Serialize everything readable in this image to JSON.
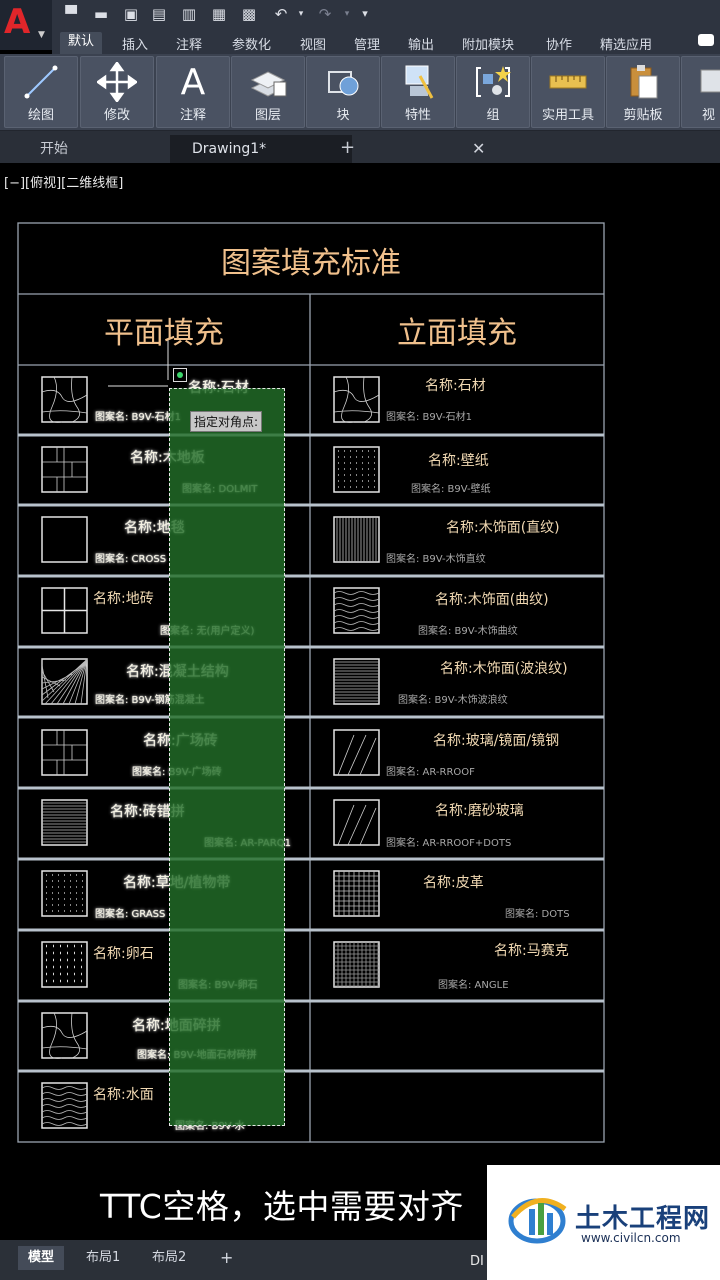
{
  "app": {
    "logo_letter": "A"
  },
  "ribbon_tabs": [
    "默认",
    "插入",
    "注释",
    "参数化",
    "视图",
    "管理",
    "输出",
    "附加模块",
    "协作",
    "精选应用"
  ],
  "ribbon_buttons": [
    {
      "label": "绘图",
      "icon": "line-draw-icon"
    },
    {
      "label": "修改",
      "icon": "move-arrows-icon"
    },
    {
      "label": "注释",
      "icon": "text-a-icon"
    },
    {
      "label": "图层",
      "icon": "layers-icon"
    },
    {
      "label": "块",
      "icon": "block-icon"
    },
    {
      "label": "特性",
      "icon": "properties-icon"
    },
    {
      "label": "组",
      "icon": "group-icon"
    },
    {
      "label": "实用工具",
      "icon": "measure-icon"
    },
    {
      "label": "剪贴板",
      "icon": "clipboard-icon"
    },
    {
      "label": "视",
      "icon": "view-icon"
    }
  ],
  "file_tabs": {
    "start": "开始",
    "drawing": "Drawing1*",
    "close": "✕",
    "add": "+"
  },
  "viewport_label": "[−][俯视][二维线框]",
  "table": {
    "title": "图案填充标准",
    "left_header": "平面填充",
    "right_header": "立面填充",
    "left_rows": [
      {
        "name": "名称:石材",
        "pattern": "图案名: B9V-石材1"
      },
      {
        "name": "名称:木地板",
        "pattern": "图案名: DOLMIT"
      },
      {
        "name": "名称:地毯",
        "pattern": "图案名: CROSS"
      },
      {
        "name": "名称:地砖",
        "pattern": "图案名: 无(用户定义)"
      },
      {
        "name": "名称:混凝土结构",
        "pattern": "图案名: B9V-钢筋混凝土"
      },
      {
        "name": "名称:广场砖",
        "pattern": "图案名: B9V-广场砖"
      },
      {
        "name": "名称:砖错拼",
        "pattern": "图案名: AR-PARQ1"
      },
      {
        "name": "名称:草地/植物带",
        "pattern": "图案名: GRASS"
      },
      {
        "name": "名称:卵石",
        "pattern": "图案名: B9V-卵石"
      },
      {
        "name": "名称:地面碎拼",
        "pattern": "图案名: B9V-地面石材碎拼"
      },
      {
        "name": "名称:水面",
        "pattern": "图案名: B9V-水"
      }
    ],
    "right_rows": [
      {
        "name": "名称:石材",
        "pattern": "图案名: B9V-石材1"
      },
      {
        "name": "名称:壁纸",
        "pattern": "图案名: B9V-壁纸"
      },
      {
        "name": "名称:木饰面(直纹)",
        "pattern": "图案名: B9V-木饰直纹"
      },
      {
        "name": "名称:木饰面(曲纹)",
        "pattern": "图案名: B9V-木饰曲纹"
      },
      {
        "name": "名称:木饰面(波浪纹)",
        "pattern": "图案名: B9V-木饰波浪纹"
      },
      {
        "name": "名称:玻璃/镜面/镜钢",
        "pattern": "图案名: AR-RROOF"
      },
      {
        "name": "名称:磨砂玻璃",
        "pattern": "图案名: AR-RROOF+DOTS"
      },
      {
        "name": "名称:皮革",
        "pattern": "图案名: DOTS"
      },
      {
        "name": "名称:马赛克",
        "pattern": "图案名: ANGLE"
      }
    ]
  },
  "tooltip": "指定对角点:",
  "subtitle": "TTC空格，选中需要对齐",
  "layout_tabs": [
    "模型",
    "布局1",
    "布局2",
    "+"
  ],
  "status_text": "DI",
  "watermark": {
    "title": "土木工程网",
    "url": "www.civilcn.com"
  }
}
